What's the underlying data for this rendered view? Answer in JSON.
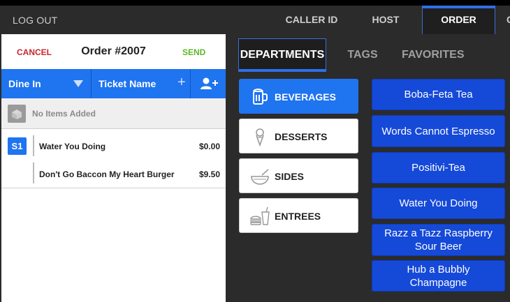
{
  "topbar": {
    "logout": "LOG OUT",
    "tabs": [
      "CALLER ID",
      "HOST",
      "ORDER"
    ],
    "clipped": "C"
  },
  "order": {
    "cancel": "CANCEL",
    "title": "Order #2007",
    "send": "SEND",
    "dine_in": "Dine In",
    "ticket_name": "Ticket Name",
    "no_items": "No Items Added",
    "seat": "S1",
    "items": [
      {
        "name": "Water You Doing",
        "price": "$0.00"
      },
      {
        "name": "Don't Go Baccon My Heart Burger",
        "price": "$9.50"
      }
    ]
  },
  "menu_tabs": [
    "DEPARTMENTS",
    "TAGS",
    "FAVORITES"
  ],
  "departments": [
    {
      "label": "BEVERAGES",
      "icon": "beverage-mug-icon",
      "active": true
    },
    {
      "label": "DESSERTS",
      "icon": "ice-cream-icon",
      "active": false
    },
    {
      "label": "SIDES",
      "icon": "bowl-icon",
      "active": false
    },
    {
      "label": "ENTREES",
      "icon": "burger-drink-icon",
      "active": false
    }
  ],
  "products": [
    "Boba-Feta Tea",
    "Words Cannot Espresso",
    "Positivi-Tea",
    "Water You Doing",
    "Razz a Tazz Raspberry Sour Beer",
    "Hub a Bubbly Champagne"
  ],
  "colors": {
    "accent": "#1f74f0",
    "product_button": "#1549d8",
    "cancel": "#c8272d",
    "send": "#5cb82a",
    "background": "#2b2b2b"
  }
}
